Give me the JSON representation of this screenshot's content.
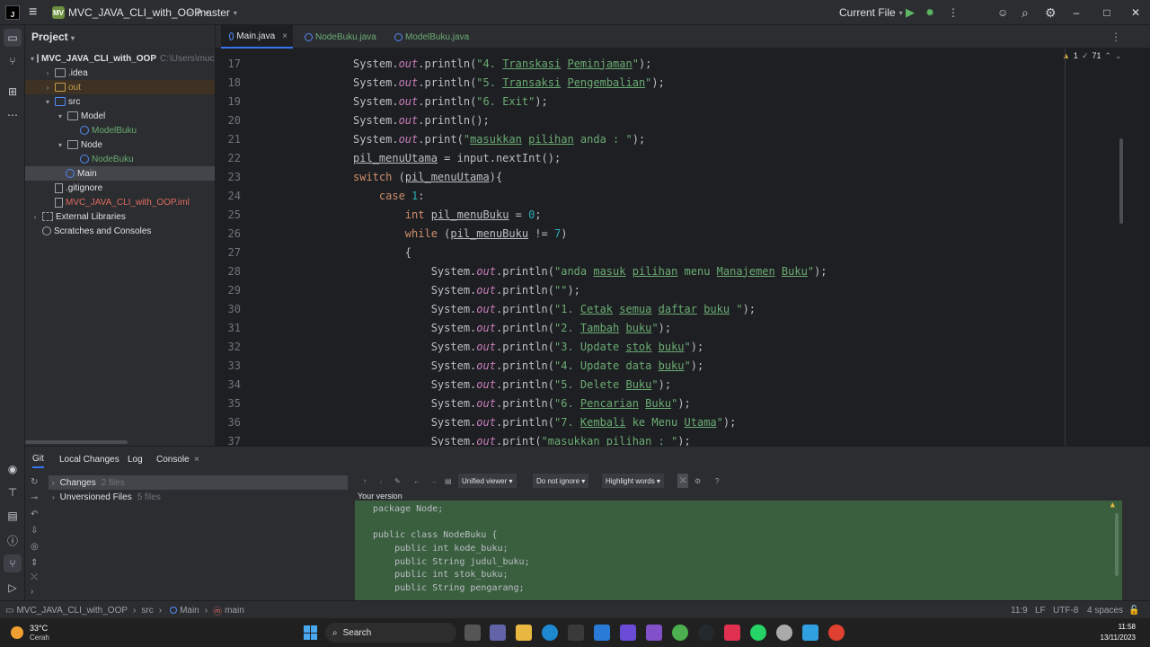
{
  "titlebar": {
    "project_badge": "MV",
    "project_name": "MVC_JAVA_CLI_with_OOP",
    "branch": "master",
    "run_config": "Current File"
  },
  "project_panel": {
    "title": "Project",
    "tree": [
      {
        "label": "MVC_JAVA_CLI_with_OOP",
        "hint": "C:\\Users\\muchi"
      },
      {
        "label": ".idea"
      },
      {
        "label": "out"
      },
      {
        "label": "src"
      },
      {
        "label": "Model"
      },
      {
        "label": "ModelBuku"
      },
      {
        "label": "Node"
      },
      {
        "label": "NodeBuku"
      },
      {
        "label": "Main"
      },
      {
        "label": ".gitignore"
      },
      {
        "label": "MVC_JAVA_CLI_with_OOP.iml"
      },
      {
        "label": "External Libraries"
      },
      {
        "label": "Scratches and Consoles"
      }
    ]
  },
  "editor": {
    "tabs": [
      {
        "label": "Main.java",
        "close": "×"
      },
      {
        "label": "NodeBuku.java"
      },
      {
        "label": "ModelBuku.java"
      }
    ],
    "inspections": {
      "warnings": "1",
      "weak": "71"
    },
    "line_numbers": [
      "17",
      "18",
      "19",
      "20",
      "21",
      "22",
      "23",
      "24",
      "25",
      "26",
      "27",
      "28",
      "29",
      "30",
      "31",
      "32",
      "33",
      "34",
      "35",
      "36",
      "37"
    ]
  },
  "bottom_panel": {
    "tabs": [
      "Git",
      "Local Changes",
      "Log",
      "Console"
    ],
    "changes_label": "Changes",
    "changes_count": "2 files",
    "unversioned_label": "Unversioned Files",
    "unversioned_count": "5 files",
    "viewer": "Unified viewer",
    "ignore": "Do not ignore",
    "highlight": "Highlight words",
    "version_label": "Your version",
    "diff_lines": [
      "package Node;",
      "",
      "public class NodeBuku {",
      "    public int kode_buku;",
      "    public String judul_buku;",
      "    public int stok_buku;",
      "    public String pengarang;"
    ]
  },
  "statusbar": {
    "breadcrumb": [
      "MVC_JAVA_CLI_with_OOP",
      "src",
      "Main",
      "main"
    ],
    "position": "11:9",
    "line_sep": "LF",
    "encoding": "UTF-8",
    "indent": "4 spaces"
  },
  "taskbar": {
    "temperature": "33°C",
    "weather": "Cerah",
    "search": "Search",
    "time": "11:58",
    "date": "13/11/2023"
  },
  "colors": {
    "accent": "#3574f0",
    "diff_added": "#395f3f",
    "keyword": "#cf8e6d",
    "string": "#6aab73"
  }
}
